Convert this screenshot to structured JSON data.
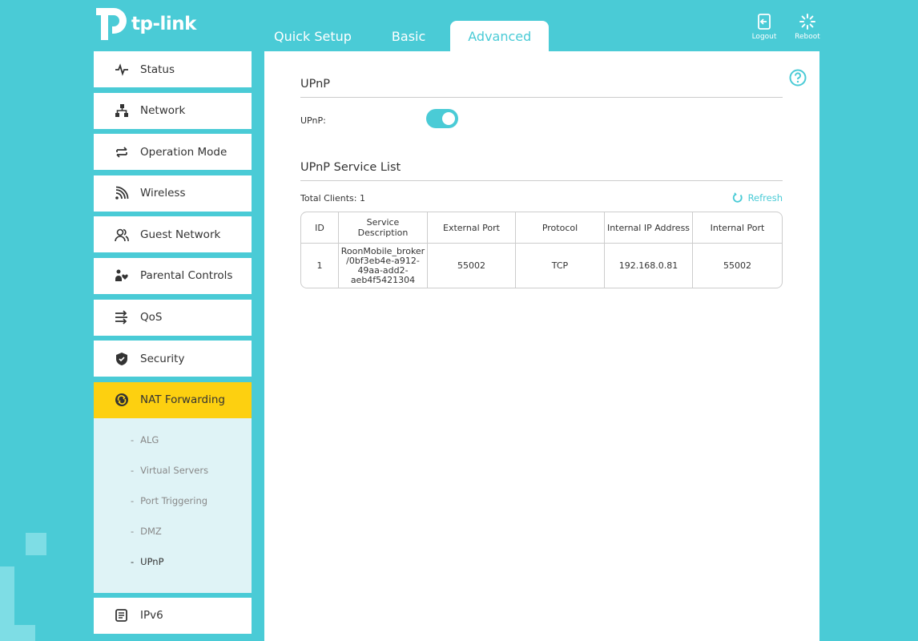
{
  "brand": {
    "logo_text": "tp-link"
  },
  "topnav": {
    "tabs": [
      "Quick Setup",
      "Basic",
      "Advanced"
    ],
    "active": "Advanced"
  },
  "actions": {
    "logout": "Logout",
    "reboot": "Reboot"
  },
  "sidebar": {
    "items": [
      {
        "label": "Status",
        "icon": "pulse-icon"
      },
      {
        "label": "Network",
        "icon": "network-icon"
      },
      {
        "label": "Operation Mode",
        "icon": "swap-icon"
      },
      {
        "label": "Wireless",
        "icon": "wifi-icon"
      },
      {
        "label": "Guest Network",
        "icon": "guest-icon"
      },
      {
        "label": "Parental Controls",
        "icon": "family-icon"
      },
      {
        "label": "QoS",
        "icon": "qos-icon"
      },
      {
        "label": "Security",
        "icon": "shield-icon"
      },
      {
        "label": "NAT Forwarding",
        "icon": "nat-icon"
      }
    ],
    "sub_items": [
      "ALG",
      "Virtual Servers",
      "Port Triggering",
      "DMZ",
      "UPnP"
    ],
    "sub_active": "UPnP",
    "after_items": [
      {
        "label": "IPv6",
        "icon": "ipv6-icon"
      }
    ],
    "dash": "-"
  },
  "main": {
    "upnp_title": "UPnP",
    "upnp_label": "UPnP:",
    "upnp_enabled": true,
    "service_title": "UPnP Service List",
    "total_clients_label": "Total Clients:",
    "total_clients": "1",
    "refresh_label": "Refresh",
    "table": {
      "headers": [
        "ID",
        "Service Description",
        "External Port",
        "Protocol",
        "Internal IP Address",
        "Internal Port"
      ],
      "rows": [
        {
          "id": "1",
          "desc": [
            "RoonMobile_broker",
            "/0bf3eb4e-a912-",
            "49aa-add2-",
            "aeb4f5421304"
          ],
          "ext_port": "55002",
          "protocol": "TCP",
          "ip": "192.168.0.81",
          "int_port": "55002"
        }
      ]
    }
  },
  "colors": {
    "accent": "#4acbd6",
    "active_menu": "#fdd010",
    "submenu_bg": "#dff3f6"
  }
}
